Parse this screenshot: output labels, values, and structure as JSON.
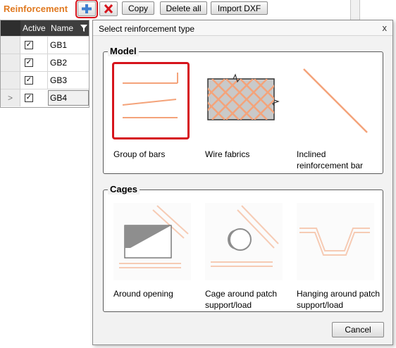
{
  "toolbar": {
    "title": "Reinforcement",
    "add_icon": "plus-icon",
    "delete_icon": "red-x-icon",
    "copy_label": "Copy",
    "delete_all_label": "Delete all",
    "import_dxf_label": "Import DXF"
  },
  "grid": {
    "columns": [
      "Active",
      "Name"
    ],
    "filter_icon": "filter-icon",
    "rows": [
      {
        "name": "GB1",
        "active": true
      },
      {
        "name": "GB2",
        "active": true
      },
      {
        "name": "GB3",
        "active": true
      },
      {
        "name": "GB4",
        "active": true
      }
    ],
    "current_row_marker": ">"
  },
  "dialog": {
    "title": "Select reinforcement type",
    "close_glyph": "x",
    "model": {
      "label": "Model",
      "items": [
        {
          "label": "Group of bars",
          "selected": true
        },
        {
          "label": "Wire fabrics"
        },
        {
          "label": "Inclined reinforcement bar"
        }
      ]
    },
    "cages": {
      "label": "Cages",
      "items": [
        {
          "label": "Around opening"
        },
        {
          "label": "Cage around patch support/load"
        },
        {
          "label": "Hanging around patch support/load"
        }
      ]
    },
    "cancel_label": "Cancel"
  },
  "colors": {
    "accent_orange": "#e07a21",
    "bar_orange": "#f4a37a",
    "selection_red": "#d6141c"
  }
}
